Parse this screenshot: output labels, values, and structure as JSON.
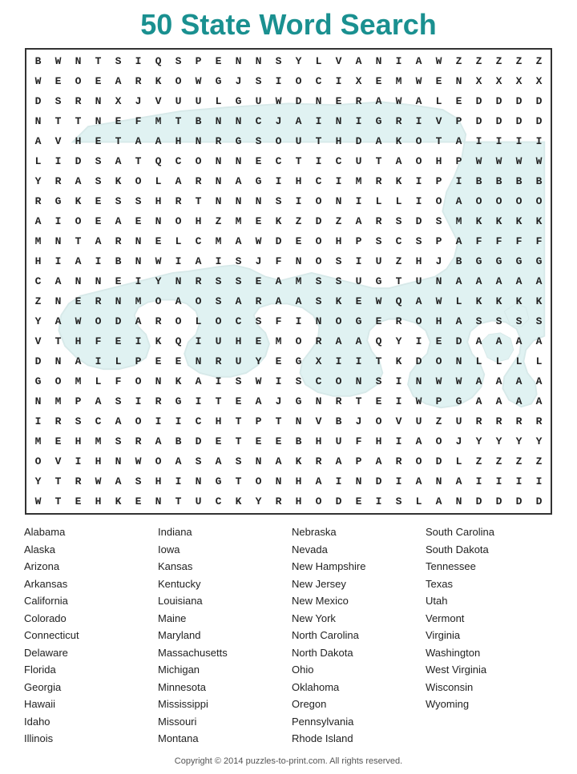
{
  "title": "50 State Word Search",
  "grid_rows": [
    "BWNTSIQSPENNSYLVANIAWZZ",
    "WEOEARKOWGJSIOCIXEMWENX",
    "DSRNXJVUULGUWDNERAWALED",
    "NTTNE FMTBNNCJAINIGRIVPD",
    "AVHETAAHNRGSOUTHDAKOTAI",
    "LIDSATQCONNECTICUTAOHPW",
    "YRASKOLARNAGIHCIMRKIPIB",
    "RGKESSHRTNNNSIONIILLIOAO",
    "AIOEAENOHZMEKZDZA RSDSMK",
    "MNTARNELCMAWDEOHPSCSPAF",
    "HIAIBNWIA ISJFNOSIUZHJBG",
    "CANNEIYNRSSEAMSSUGTUNAA",
    "ZNERNMOAOSARAASKEWQAWLK",
    "YAWOD AROLOCSFINOGEROHAS",
    "VTHFEIKQIUHEMORAAQYIEDA",
    "DNAILPEENRUYEGXIITKDONL",
    "GOMLFONKAISWISCONSINWWA",
    "NMPASIRGITEAJGNRTEI WPGA",
    "IRSCAOIICHTPTNVBJOVUZUR",
    "MEHMSRABDETEE BHUFHIAOJY",
    "OVIHNWOASASNAKRAPAR ODLZ",
    "YTRWASHINGTONHAINDIANAÍ",
    "WTEHKENTUCKYRH ODEISLAND"
  ],
  "rows": [
    [
      "B",
      "W",
      "N",
      "T",
      "S",
      "I",
      "Q",
      "S",
      "P",
      "E",
      "N",
      "N",
      "S",
      "Y",
      "L",
      "V",
      "A",
      "N",
      "I",
      "A",
      "W",
      "Z",
      "Z",
      "Z",
      "Z",
      "Z"
    ],
    [
      "W",
      "E",
      "O",
      "E",
      "A",
      "R",
      "K",
      "O",
      "W",
      "G",
      "J",
      "S",
      "I",
      "O",
      "C",
      "I",
      "X",
      "E",
      "M",
      "W",
      "E",
      "N",
      "X",
      "X",
      "X",
      "X"
    ],
    [
      "D",
      "S",
      "R",
      "N",
      "X",
      "J",
      "V",
      "U",
      "U",
      "L",
      "G",
      "U",
      "W",
      "D",
      "N",
      "E",
      "R",
      "A",
      "W",
      "A",
      "L",
      "E",
      "D",
      "D",
      "D",
      "D"
    ],
    [
      "N",
      "T",
      "T",
      "N",
      "E",
      "F",
      "M",
      "T",
      "B",
      "N",
      "N",
      "C",
      "J",
      "A",
      "I",
      "N",
      "I",
      "G",
      "R",
      "I",
      "V",
      "P",
      "D",
      "D",
      "D",
      "D"
    ],
    [
      "A",
      "V",
      "H",
      "E",
      "T",
      "A",
      "A",
      "H",
      "N",
      "R",
      "G",
      "S",
      "O",
      "U",
      "T",
      "H",
      "D",
      "A",
      "K",
      "O",
      "T",
      "A",
      "I",
      "I",
      "I",
      "I"
    ],
    [
      "L",
      "I",
      "D",
      "S",
      "A",
      "T",
      "Q",
      "C",
      "O",
      "N",
      "N",
      "E",
      "C",
      "T",
      "I",
      "C",
      "U",
      "T",
      "A",
      "O",
      "H",
      "P",
      "W",
      "W",
      "W",
      "W"
    ],
    [
      "Y",
      "R",
      "A",
      "S",
      "K",
      "O",
      "L",
      "A",
      "R",
      "N",
      "A",
      "G",
      "I",
      "H",
      "C",
      "I",
      "M",
      "R",
      "K",
      "I",
      "P",
      "I",
      "B",
      "B",
      "B",
      "B"
    ],
    [
      "R",
      "G",
      "K",
      "E",
      "S",
      "S",
      "H",
      "R",
      "T",
      "N",
      "N",
      "N",
      "S",
      "I",
      "O",
      "N",
      "I",
      "L",
      "L",
      "I",
      "O",
      "A",
      "O",
      "O",
      "O",
      "O"
    ],
    [
      "A",
      "I",
      "O",
      "E",
      "A",
      "E",
      "N",
      "O",
      "H",
      "Z",
      "M",
      "E",
      "K",
      "Z",
      "D",
      "Z",
      "A",
      "R",
      "S",
      "D",
      "S",
      "M",
      "K",
      "K",
      "K",
      "K"
    ],
    [
      "M",
      "N",
      "T",
      "A",
      "R",
      "N",
      "E",
      "L",
      "C",
      "M",
      "A",
      "W",
      "D",
      "E",
      "O",
      "H",
      "P",
      "S",
      "C",
      "S",
      "P",
      "A",
      "F",
      "F",
      "F",
      "F"
    ],
    [
      "H",
      "I",
      "A",
      "I",
      "B",
      "N",
      "W",
      "I",
      "A",
      "I",
      "S",
      "J",
      "F",
      "N",
      "O",
      "S",
      "I",
      "U",
      "Z",
      "H",
      "J",
      "B",
      "G",
      "G",
      "G",
      "G"
    ],
    [
      "C",
      "A",
      "N",
      "N",
      "E",
      "I",
      "Y",
      "N",
      "R",
      "S",
      "S",
      "E",
      "A",
      "M",
      "S",
      "S",
      "U",
      "G",
      "T",
      "U",
      "N",
      "A",
      "A",
      "A",
      "A",
      "A"
    ],
    [
      "Z",
      "N",
      "E",
      "R",
      "N",
      "M",
      "O",
      "A",
      "O",
      "S",
      "A",
      "R",
      "A",
      "A",
      "S",
      "K",
      "E",
      "W",
      "Q",
      "A",
      "W",
      "L",
      "K",
      "K",
      "K",
      "K"
    ],
    [
      "Y",
      "A",
      "W",
      "O",
      "D",
      "A",
      "R",
      "O",
      "L",
      "O",
      "C",
      "S",
      "F",
      "I",
      "N",
      "O",
      "G",
      "E",
      "R",
      "O",
      "H",
      "A",
      "S",
      "S",
      "S",
      "S"
    ],
    [
      "V",
      "T",
      "H",
      "F",
      "E",
      "I",
      "K",
      "Q",
      "I",
      "U",
      "H",
      "E",
      "M",
      "O",
      "R",
      "A",
      "A",
      "Q",
      "Y",
      "I",
      "E",
      "D",
      "A",
      "A",
      "A",
      "A"
    ],
    [
      "D",
      "N",
      "A",
      "I",
      "L",
      "P",
      "E",
      "E",
      "N",
      "R",
      "U",
      "Y",
      "E",
      "G",
      "X",
      "I",
      "I",
      "T",
      "K",
      "D",
      "O",
      "N",
      "L",
      "L",
      "L",
      "L"
    ],
    [
      "G",
      "O",
      "M",
      "L",
      "F",
      "O",
      "N",
      "K",
      "A",
      "I",
      "S",
      "W",
      "I",
      "S",
      "C",
      "O",
      "N",
      "S",
      "I",
      "N",
      "W",
      "W",
      "A",
      "A",
      "A",
      "A"
    ],
    [
      "N",
      "M",
      "P",
      "A",
      "S",
      "I",
      "R",
      "G",
      "I",
      "T",
      "E",
      "A",
      "J",
      "G",
      "N",
      "R",
      "T",
      "E",
      "I",
      "W",
      "P",
      "G",
      "A",
      "A",
      "A",
      "A"
    ],
    [
      "I",
      "R",
      "S",
      "C",
      "A",
      "O",
      "I",
      "I",
      "C",
      "H",
      "T",
      "P",
      "T",
      "N",
      "V",
      "B",
      "J",
      "O",
      "V",
      "U",
      "Z",
      "U",
      "R",
      "R",
      "R",
      "R"
    ],
    [
      "M",
      "E",
      "H",
      "M",
      "S",
      "R",
      "A",
      "B",
      "D",
      "E",
      "T",
      "E",
      "E",
      "B",
      "H",
      "U",
      "F",
      "H",
      "I",
      "A",
      "O",
      "J",
      "Y",
      "Y",
      "Y",
      "Y"
    ],
    [
      "O",
      "V",
      "I",
      "H",
      "N",
      "W",
      "O",
      "A",
      "S",
      "A",
      "S",
      "N",
      "A",
      "K",
      "R",
      "A",
      "P",
      "A",
      "R",
      "O",
      "D",
      "L",
      "Z",
      "Z",
      "Z",
      "Z"
    ],
    [
      "Y",
      "T",
      "R",
      "W",
      "A",
      "S",
      "H",
      "I",
      "N",
      "G",
      "T",
      "O",
      "N",
      "H",
      "A",
      "I",
      "N",
      "D",
      "I",
      "A",
      "N",
      "A",
      "I",
      "I",
      "I",
      "I"
    ],
    [
      "W",
      "T",
      "E",
      "H",
      "K",
      "E",
      "N",
      "T",
      "U",
      "C",
      "K",
      "Y",
      "R",
      "H",
      "O",
      "D",
      "E",
      "I",
      "S",
      "L",
      "A",
      "N",
      "D",
      "D",
      "D",
      "D"
    ]
  ],
  "word_columns": [
    {
      "words": [
        "Alabama",
        "Alaska",
        "Arizona",
        "Arkansas",
        "California",
        "Colorado",
        "Connecticut",
        "Delaware",
        "Florida",
        "Georgia",
        "Hawaii",
        "Idaho",
        "Illinois"
      ]
    },
    {
      "words": [
        "Indiana",
        "Iowa",
        "Kansas",
        "Kentucky",
        "Louisiana",
        "Maine",
        "Maryland",
        "Massachusetts",
        "Michigan",
        "Minnesota",
        "Mississippi",
        "Missouri",
        "Montana"
      ]
    },
    {
      "words": [
        "Nebraska",
        "Nevada",
        "New Hampshire",
        "New Jersey",
        "New Mexico",
        "New York",
        "North Carolina",
        "North Dakota",
        "Ohio",
        "Oklahoma",
        "Oregon",
        "Pennsylvania",
        "Rhode Island"
      ]
    },
    {
      "words": [
        "South Carolina",
        "South Dakota",
        "Tennessee",
        "Texas",
        "Utah",
        "Vermont",
        "Virginia",
        "Washington",
        "West Virginia",
        "Wisconsin",
        "Wyoming"
      ]
    }
  ],
  "copyright": "Copyright © 2014 puzzles-to-print.com. All rights reserved."
}
